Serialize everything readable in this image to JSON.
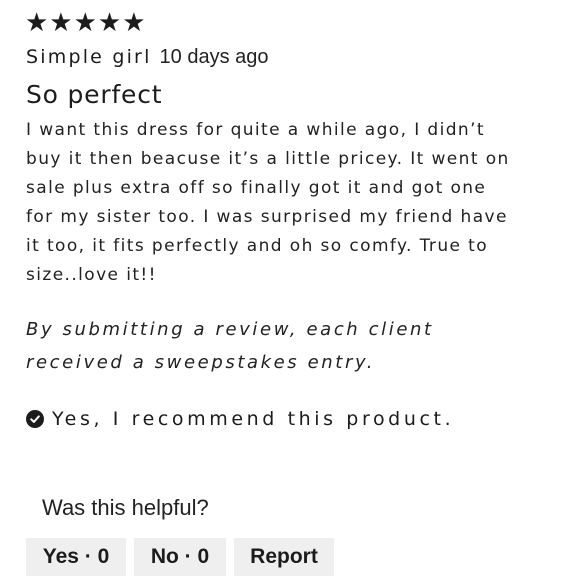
{
  "review": {
    "rating": 5,
    "stars": "★★★★★",
    "author": "Simple girl",
    "age": "10 days ago",
    "title": "So perfect",
    "body_lines": [
      "I want this dress for quite a while ago, I didn’t",
      "buy it then beacuse it’s a little pricey. It went on",
      "sale plus extra off so finally got it and got one",
      "for my sister too. I was surprised my friend have",
      "it too, it fits perfectly and oh so comfy. True to",
      "size..love it!!"
    ],
    "disclaimer_lines": [
      "By submitting a review, each client",
      "received a sweepstakes entry."
    ],
    "recommend_icon": "check-circle-icon",
    "recommend_text": "Yes, I recommend this product."
  },
  "helpful": {
    "question": "Was this helpful?",
    "yes_label": "Yes · 0",
    "no_label": "No · 0",
    "report_label": "Report"
  }
}
